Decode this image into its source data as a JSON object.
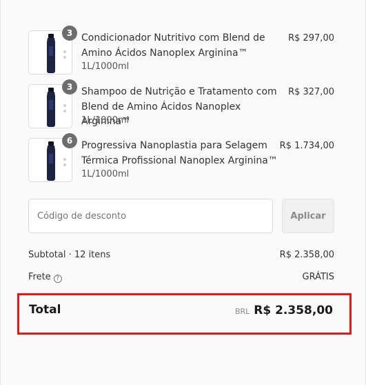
{
  "cart": {
    "items": [
      {
        "name": "Condicionador Nutritivo com Blend de Amino Ácidos Nanoplex Arginina™",
        "variant": "1L/1000ml",
        "price": "R$ 297,00",
        "quantity": "3",
        "image_icon": "conditioner-bottle-icon"
      },
      {
        "name": "Shampoo de Nutrição e Tratamento com Blend de Amino Ácidos Nanoplex Arginina™",
        "variant": "1L/1000ml",
        "price": "R$ 327,00",
        "quantity": "3",
        "image_icon": "shampoo-bottle-icon"
      },
      {
        "name": "Progressiva Nanoplastia para Selagem Térmica Profissional Nanoplex Arginina™",
        "variant": "1L/1000ml",
        "price": "R$ 1.734,00",
        "quantity": "6",
        "image_icon": "treatment-bottle-icon"
      }
    ]
  },
  "discount": {
    "placeholder": "Código de desconto",
    "value": "",
    "apply_label": "Aplicar"
  },
  "summary": {
    "subtotal_label": "Subtotal · 12 itens",
    "subtotal_value": "R$ 2.358,00",
    "shipping_label": "Frete",
    "shipping_help_icon": "question-circle-icon",
    "shipping_value": "GRÁTIS",
    "total_label": "Total",
    "currency_code": "BRL",
    "total_value": "R$ 2.358,00"
  },
  "colors": {
    "highlight_border": "#e01b1b",
    "badge": "#6d6d6d",
    "bottle": "#1d2342"
  }
}
